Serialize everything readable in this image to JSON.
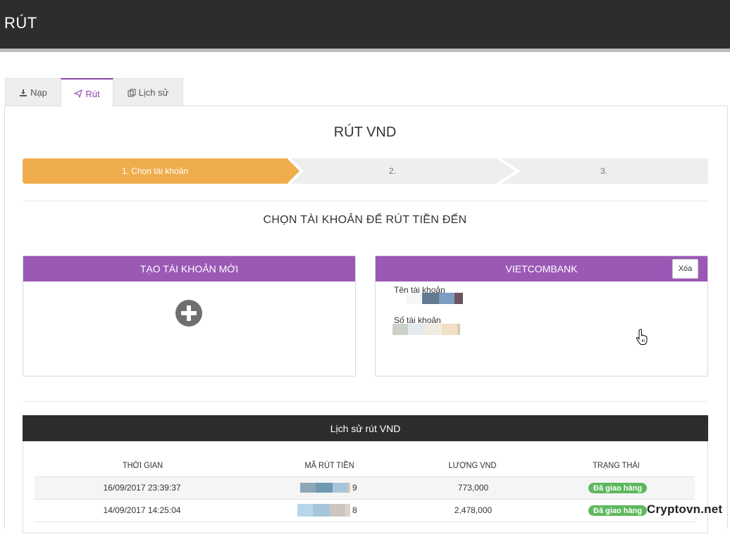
{
  "header": {
    "title": "RÚT"
  },
  "tabs": [
    {
      "label": "Nạp",
      "icon": "download-icon"
    },
    {
      "label": "Rút",
      "icon": "paper-plane-icon"
    },
    {
      "label": "Lịch sử",
      "icon": "history-icon"
    }
  ],
  "active_tab": "Rút",
  "page": {
    "heading": "RÚT VND",
    "subheading": "CHỌN TÀI KHOẢN ĐỂ RÚT TIỀN ĐẾN"
  },
  "steps": [
    {
      "label": "1. Chọn tài khoản",
      "active": true
    },
    {
      "label": "2.",
      "active": false
    },
    {
      "label": "3.",
      "active": false
    }
  ],
  "new_account_card": {
    "title": "TẠO TÀI KHOẢN MỚI",
    "icon": "plus-circle-icon"
  },
  "bank_card": {
    "title": "VIETCOMBANK",
    "delete_label": "Xóa",
    "account_name_label": "Tên tài khoản",
    "account_number_label": "Số tài khoản"
  },
  "history": {
    "title": "Lịch sử rút VND",
    "columns": [
      "THỜI GIAN",
      "MÃ RÚT TIỀN",
      "LƯỢNG VND",
      "TRẠNG THÁI"
    ],
    "rows": [
      {
        "time": "16/09/2017 23:39:37",
        "code_suffix": "9",
        "amount": "773,000",
        "status": "Đã giao hàng"
      },
      {
        "time": "14/09/2017 14:25:04",
        "code_suffix": "8",
        "amount": "2,478,000",
        "status": "Đã giao hàng"
      }
    ]
  },
  "watermark": "Cryptovn.net",
  "colors": {
    "accent": "#9b59b6",
    "active_tab_text": "#8e44ad",
    "step_active": "#f0ad4e",
    "step_inactive": "#eeeeee",
    "topbar": "#2d2d2d",
    "status_success": "#5cb85c"
  }
}
